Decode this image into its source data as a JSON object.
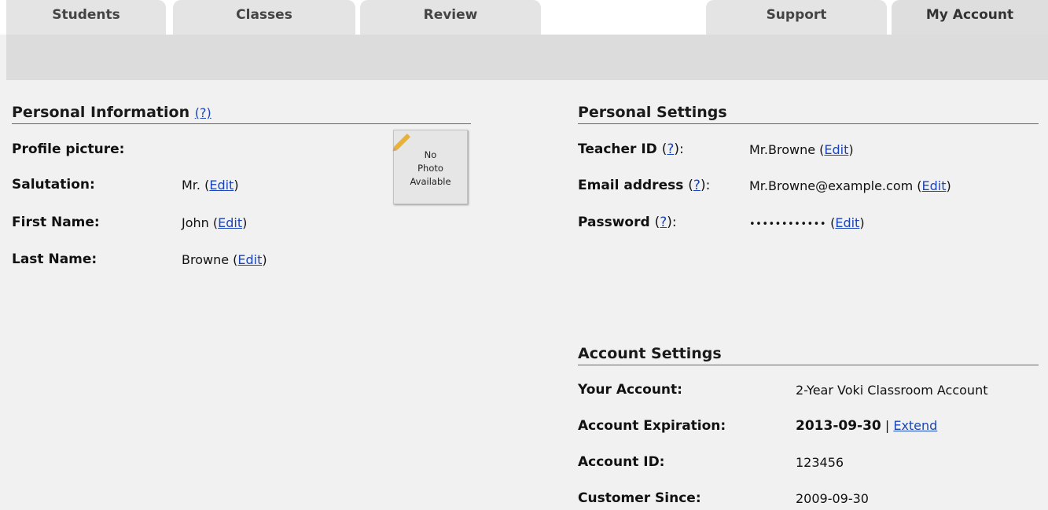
{
  "tabs": {
    "students": "Students",
    "classes": "Classes",
    "review": "Review",
    "support": "Support",
    "my_account": "My Account"
  },
  "personal_info": {
    "title": "Personal Information",
    "help": "(?)",
    "profile_picture_label": "Profile picture:",
    "photo_text": [
      "No",
      "Photo",
      "Available"
    ],
    "salutation_label": "Salutation:",
    "salutation_value": "Mr.",
    "first_name_label": "First Name:",
    "first_name_value": "John",
    "last_name_label": "Last Name:",
    "last_name_value": "Browne",
    "edit": "Edit"
  },
  "personal_settings": {
    "title": "Personal Settings",
    "teacher_id_label": "Teacher ID",
    "teacher_id_value": "Mr.Browne",
    "email_label": "Email address",
    "email_value": "Mr.Browne@example.com",
    "password_label": "Password",
    "password_value": "••••••••••••",
    "help": "?",
    "edit": "Edit"
  },
  "account_settings": {
    "title": "Account Settings",
    "your_account_label": "Your Account:",
    "your_account_value": "2-Year Voki Classroom Account",
    "expiration_label": "Account Expiration:",
    "expiration_value": "2013-09-30",
    "separator": "|",
    "extend": "Extend",
    "account_id_label": "Account ID:",
    "account_id_value": "123456",
    "customer_since_label": "Customer Since:",
    "customer_since_value": "2009-09-30"
  },
  "colors": {
    "link": "#1a44b8",
    "tab_bg": "#e4e4e4",
    "page_bg": "#f1f1f1"
  }
}
